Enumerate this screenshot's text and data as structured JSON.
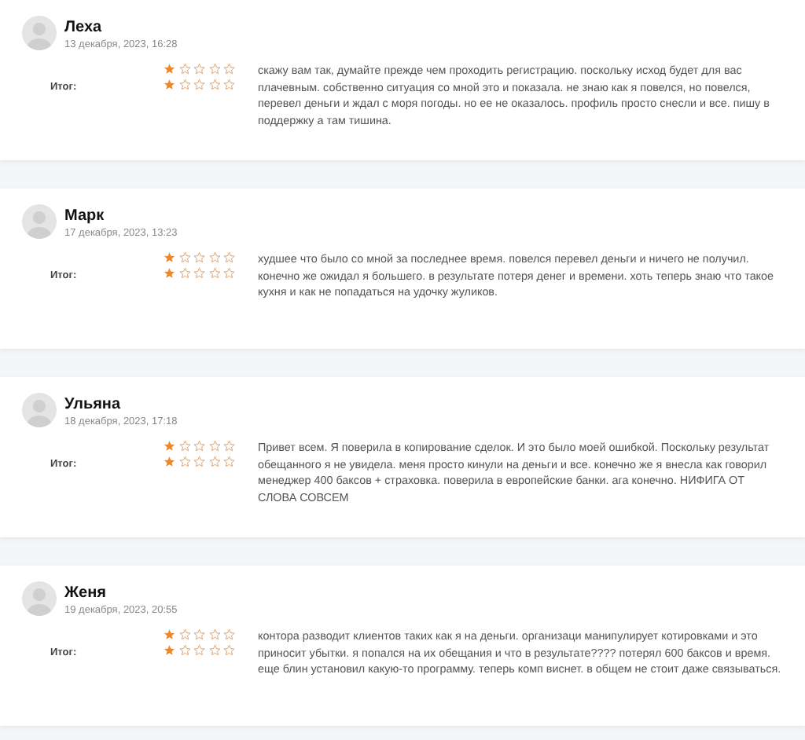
{
  "reviews": [
    {
      "name": "Леха",
      "date": "13 декабря, 2023, 16:28",
      "summary_label": "Итог:",
      "ratings": [
        {
          "stars": 1
        },
        {
          "stars": 1
        }
      ],
      "text": "скажу вам так, думайте прежде чем проходить регистрацию. поскольку исход будет для вас плачевным. собственно ситуация со мной это и показала. не знаю как я повелся, но повелся, перевел деньги и ждал с моря погоды. но ее не оказалось. профиль просто снесли и все. пишу в поддержку а там тишина."
    },
    {
      "name": "Марк",
      "date": "17 декабря, 2023, 13:23",
      "summary_label": "Итог:",
      "ratings": [
        {
          "stars": 1
        },
        {
          "stars": 1
        }
      ],
      "text": "худшее что было со мной за последнее время. повелся перевел деньги и ничего не получил. конечно же ожидал я большего. в результате потеря денег и времени. хоть теперь знаю что такое кухня и как не попадаться на удочку жуликов."
    },
    {
      "name": "Ульяна",
      "date": "18 декабря, 2023, 17:18",
      "summary_label": "Итог:",
      "ratings": [
        {
          "stars": 1
        },
        {
          "stars": 1
        }
      ],
      "text": "Привет всем. Я поверила в копирование сделок. И это было моей ошибкой. Поскольку результат обещанного я не увидела. меня просто кинули на деньги и все. конечно же я внесла как говорил менеджер 400 баксов + страховка. поверила в европейские банки. ага конечно. НИФИГА ОТ СЛОВА СОВСЕМ"
    },
    {
      "name": "Женя",
      "date": "19 декабря, 2023, 20:55",
      "summary_label": "Итог:",
      "ratings": [
        {
          "stars": 1
        },
        {
          "stars": 1
        }
      ],
      "text": "контора разводит клиентов таких как я на деньги. организаци манипулирует котировками и это приносит убытки. я попался на их обещания и что в результате???? потерял 600 баксов и время. еще блин установил какую-то программу. теперь комп виснет. в общем не стоит даже связываться."
    }
  ]
}
